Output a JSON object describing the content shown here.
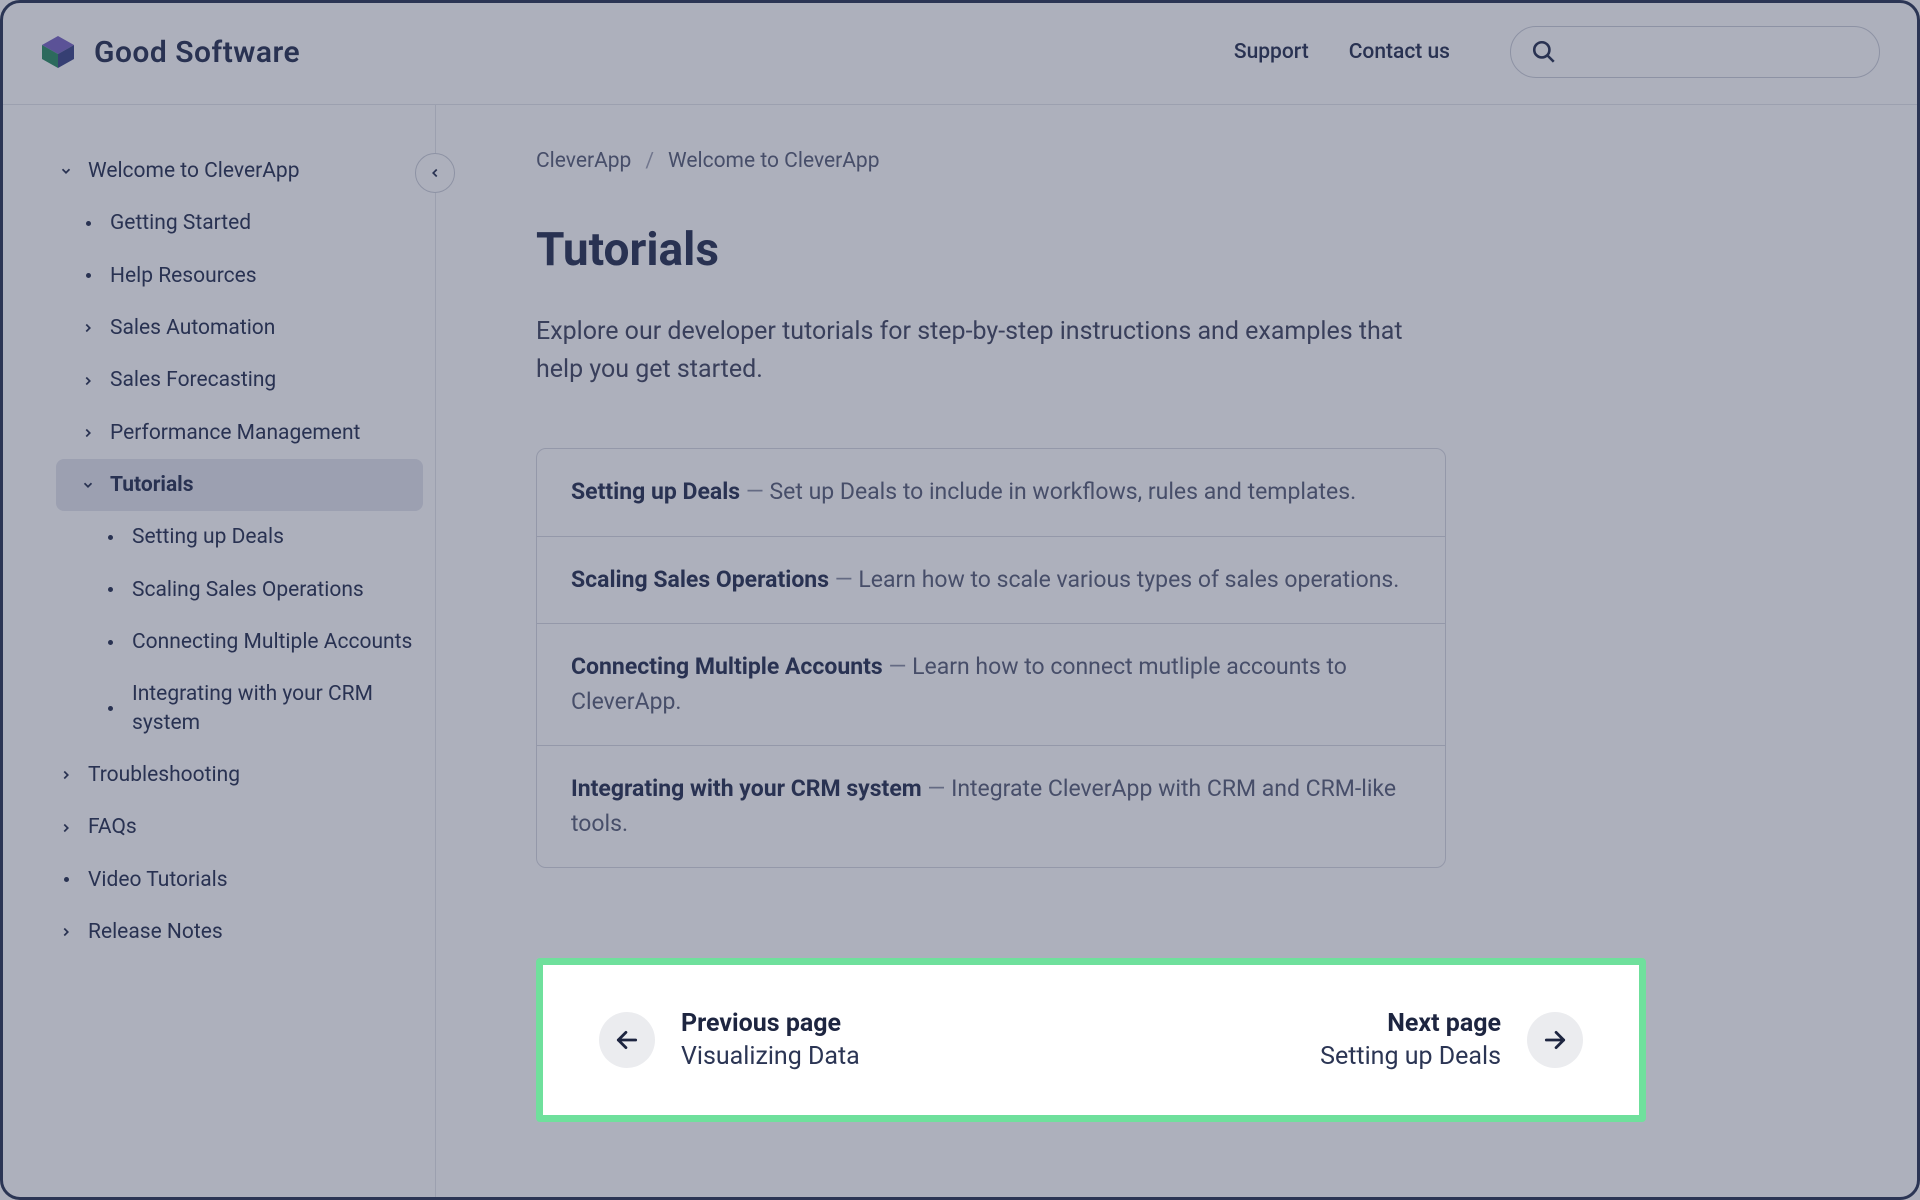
{
  "brand": {
    "name": "Good Software"
  },
  "header": {
    "links": [
      "Support",
      "Contact us"
    ],
    "search_placeholder": ""
  },
  "sidebar": {
    "items": [
      {
        "label": "Welcome to CleverApp",
        "level": 1,
        "icon": "chevron-down"
      },
      {
        "label": "Getting Started",
        "level": 2,
        "icon": "dot"
      },
      {
        "label": "Help Resources",
        "level": 2,
        "icon": "dot"
      },
      {
        "label": "Sales Automation",
        "level": 2,
        "icon": "chevron-right"
      },
      {
        "label": "Sales Forecasting",
        "level": 2,
        "icon": "chevron-right"
      },
      {
        "label": "Performance Management",
        "level": 2,
        "icon": "chevron-right"
      },
      {
        "label": "Tutorials",
        "level": 2,
        "icon": "chevron-down",
        "active": true
      },
      {
        "label": "Setting up Deals",
        "level": 3,
        "icon": "dot"
      },
      {
        "label": "Scaling Sales Operations",
        "level": 3,
        "icon": "dot"
      },
      {
        "label": "Connecting Multiple Accounts",
        "level": 3,
        "icon": "dot"
      },
      {
        "label": "Integrating with your CRM system",
        "level": 3,
        "icon": "dot"
      },
      {
        "label": "Troubleshooting",
        "level": 1,
        "icon": "chevron-right"
      },
      {
        "label": "FAQs",
        "level": 1,
        "icon": "chevron-right"
      },
      {
        "label": "Video Tutorials",
        "level": 1,
        "icon": "dot"
      },
      {
        "label": "Release Notes",
        "level": 1,
        "icon": "chevron-right"
      }
    ]
  },
  "breadcrumb": {
    "items": [
      "CleverApp",
      "Welcome to CleverApp"
    ],
    "sep": "/"
  },
  "page": {
    "title": "Tutorials",
    "lead": "Explore our developer tutorials for step-by-step instructions and examples that help you get started."
  },
  "tutorials": [
    {
      "title": "Setting up Deals",
      "desc": "Set up Deals to include in workflows, rules and templates."
    },
    {
      "title": "Scaling Sales Operations",
      "desc": "Learn how to scale various types of sales operations."
    },
    {
      "title": "Connecting Multiple Accounts",
      "desc": "Learn how to connect mutliple accounts to CleverApp."
    },
    {
      "title": "Integrating with your CRM system",
      "desc": "Integrate CleverApp with CRM and CRM-like tools."
    }
  ],
  "pager": {
    "prev": {
      "label": "Previous page",
      "title": "Visualizing Data"
    },
    "next": {
      "label": "Next page",
      "title": "Setting up Deals"
    }
  }
}
